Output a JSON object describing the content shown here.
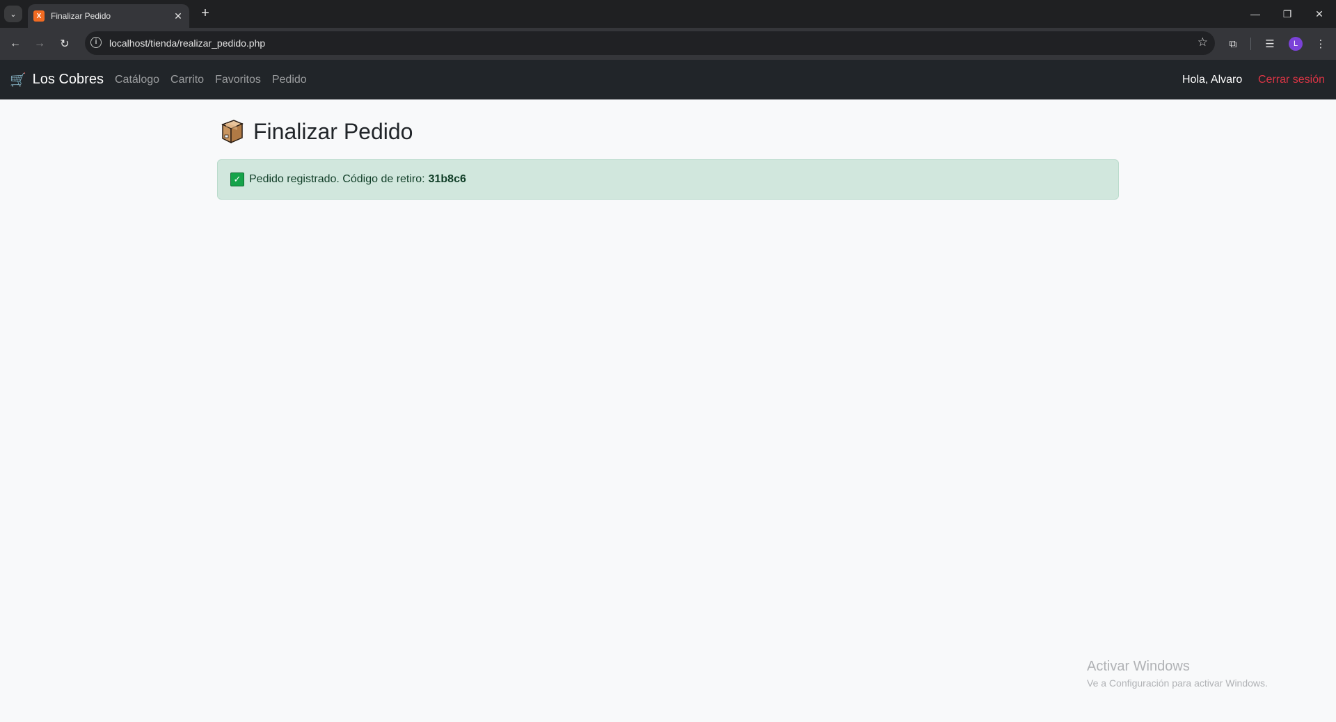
{
  "browser": {
    "tab_title": "Finalizar Pedido",
    "tab_favicon_text": "X",
    "url": "localhost/tienda/realizar_pedido.php",
    "profile_initial": "L"
  },
  "navbar": {
    "brand": "Los Cobres",
    "links": [
      "Catálogo",
      "Carrito",
      "Favoritos",
      "Pedido"
    ],
    "greeting": "Hola, Alvaro",
    "logout": "Cerrar sesión"
  },
  "page": {
    "title": "Finalizar Pedido",
    "alert_text": "Pedido registrado. Código de retiro:",
    "pickup_code": "31b8c6"
  },
  "watermark": {
    "title": "Activar Windows",
    "subtitle": "Ve a Configuración para activar Windows."
  },
  "colors": {
    "navbar_bg": "#212529",
    "alert_bg": "#d1e7dd",
    "logout": "#dc3545",
    "page_bg": "#f8f9fa"
  }
}
